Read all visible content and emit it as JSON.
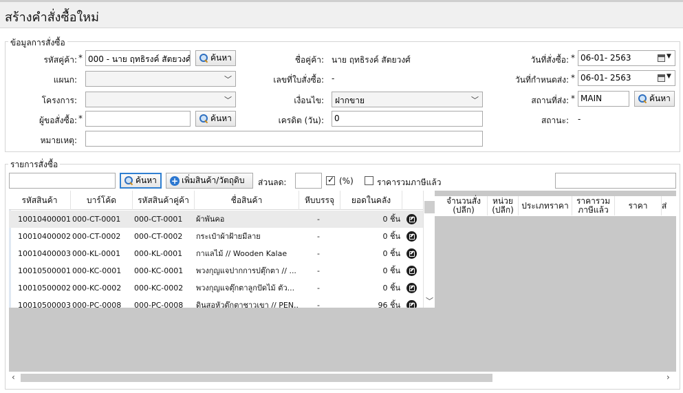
{
  "window": {
    "title": "สร้างคำสั่งซื้อใหม่"
  },
  "order_info": {
    "legend": "ข้อมูลการสั่งซื้อ",
    "supplier_code_label": "รหัสคู่ค้า:",
    "supplier_code_value": "000 - นาย ฤทธิรงค์ สัตยวงศ์",
    "search_label": "ค้นหา",
    "department_label": "แผนก:",
    "department_value": "",
    "project_label": "โครงการ:",
    "project_value": "",
    "requester_label": "ผู้ขอสั่งซื้อ:",
    "requester_value": "",
    "note_label": "หมายเหตุ:",
    "note_value": "",
    "supplier_name_label": "ชื่อคู่ค้า:",
    "supplier_name_value": "นาย ฤทธิรงค์ สัตยวงศ์",
    "po_number_label": "เลขที่ใบสั่งซื้อ:",
    "po_number_value": "-",
    "condition_label": "เงื่อนไข:",
    "condition_value": "ฝากขาย",
    "credit_label": "เครดิต (วัน):",
    "credit_value": "0",
    "order_date_label": "วันที่สั่งซื้อ:",
    "order_date_value": "06-01- 2563",
    "due_date_label": "วันที่กำหนดส่ง:",
    "due_date_value": "06-01- 2563",
    "ship_to_label": "สถานที่ส่ง:",
    "ship_to_value": "MAIN",
    "status_label": "สถานะ:",
    "status_value": "-",
    "required_mark": "*"
  },
  "order_items": {
    "legend": "รายการสั่งซื้อ",
    "search_value": "",
    "search_label": "ค้นหา",
    "add_label": "เพิ่มสินค้า/วัตถุดิบ",
    "discount_label": "ส่วนลด:",
    "discount_value": "",
    "percent_label": "(%)",
    "percent_checked": true,
    "vat_included_label": "ราคารวมภาษีแล้ว",
    "vat_included_checked": false,
    "filter_value": ""
  },
  "product_lookup": {
    "columns": [
      "รหัสสินค้า",
      "บาร์โค้ด",
      "รหัสสินค้าคู่ค้า",
      "ชื่อสินค้า",
      "หีบบรรจุ",
      "ยอดในคลัง"
    ],
    "rows": [
      {
        "code": "10010400001",
        "barcode": "000-CT-0001",
        "supplier_code": "000-CT-0001",
        "name": "ผ้าพันคอ",
        "pack": "-",
        "stock": "0 ชิ้น"
      },
      {
        "code": "10010400002",
        "barcode": "000-CT-0002",
        "supplier_code": "000-CT-0002",
        "name": "กระเป๋าผ้าฝ้ายมีลาย",
        "pack": "-",
        "stock": "0 ชิ้น"
      },
      {
        "code": "10010400003",
        "barcode": "000-KL-0001",
        "supplier_code": "000-KL-0001",
        "name": "กาแลไม้ // Wooden Kalae",
        "pack": "-",
        "stock": "0 ชิ้น"
      },
      {
        "code": "10010500001",
        "barcode": "000-KC-0001",
        "supplier_code": "000-KC-0001",
        "name": "พวงกุญแจปากการปตุ๊กตา // ...",
        "pack": "-",
        "stock": "0 ชิ้น"
      },
      {
        "code": "10010500002",
        "barcode": "000-KC-0002",
        "supplier_code": "000-KC-0002",
        "name": "พวงกุญแจตุ๊กตาลูกปัดไม้ ตัว...",
        "pack": "-",
        "stock": "0 ชิ้น"
      },
      {
        "code": "10010500003",
        "barcode": "000-PC-0008",
        "supplier_code": "000-PC-0008",
        "name": "ดินสอหัวตุ๊กตาชาวเขา // PEN...",
        "pack": "-",
        "stock": "96 ชิ้น"
      }
    ]
  },
  "items_grid": {
    "columns": [
      "จำนวนสั่ง\n(ปลีก)",
      "หน่วย\n(ปลีก)",
      "ประเภทราคา",
      "ราคารวม\nภาษีแล้ว",
      "ราคา",
      "ส่"
    ]
  },
  "colors": {
    "grid_bg": "#c8c8c8",
    "focus_border": "#2f7fd1",
    "row_selected": "#eaeaea"
  }
}
